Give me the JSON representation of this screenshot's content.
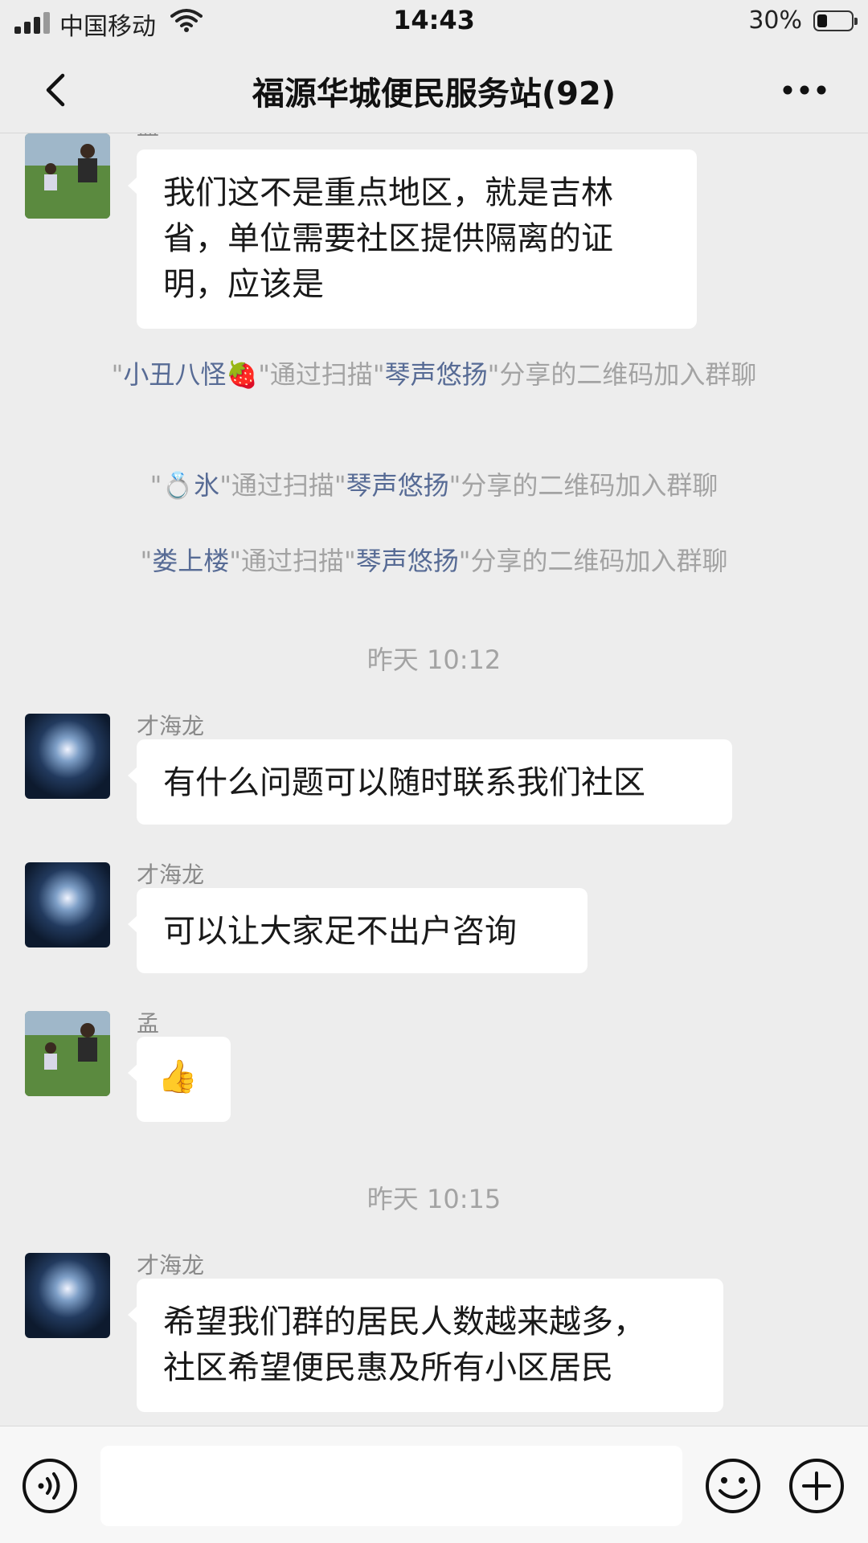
{
  "status": {
    "carrier": "中国移动",
    "time": "14:43",
    "battery_pct": "30%",
    "battery_level": 0.3
  },
  "nav": {
    "title": "福源华城便民服务站(92)"
  },
  "chat": {
    "msg1": {
      "sender": "孟",
      "lines": [
        "我们这不是重点地区，就是吉林",
        "省，单位需要社区提供隔离的证",
        "明，应该是"
      ]
    },
    "sys1": {
      "q1": "\"",
      "name1": "小丑八怪🍓",
      "mid": "\"通过扫描\"",
      "name2": "琴声悠扬",
      "tail": "\"分享的二维码加入群聊"
    },
    "sys2": {
      "q1": "\"",
      "name1": "💍氷",
      "mid": "\"通过扫描\"",
      "name2": "琴声悠扬",
      "tail": "\"分享的二维码加入群聊"
    },
    "sys3": {
      "q1": "\"",
      "name1": "娄上楼",
      "mid": "\"通过扫描\"",
      "name2": "琴声悠扬",
      "tail": "\"分享的二维码加入群聊"
    },
    "time1": "昨天 10:12",
    "msg2": {
      "sender": "才海龙",
      "text": "有什么问题可以随时联系我们社区"
    },
    "msg3": {
      "sender": "才海龙",
      "text": "可以让大家足不出户咨询"
    },
    "msg4": {
      "sender": "孟",
      "text": "👍"
    },
    "time2": "昨天 10:15",
    "msg5": {
      "sender": "才海龙",
      "lines": [
        "希望我们群的居民人数越来越多，",
        "社区希望便民惠及所有小区居民"
      ]
    }
  }
}
